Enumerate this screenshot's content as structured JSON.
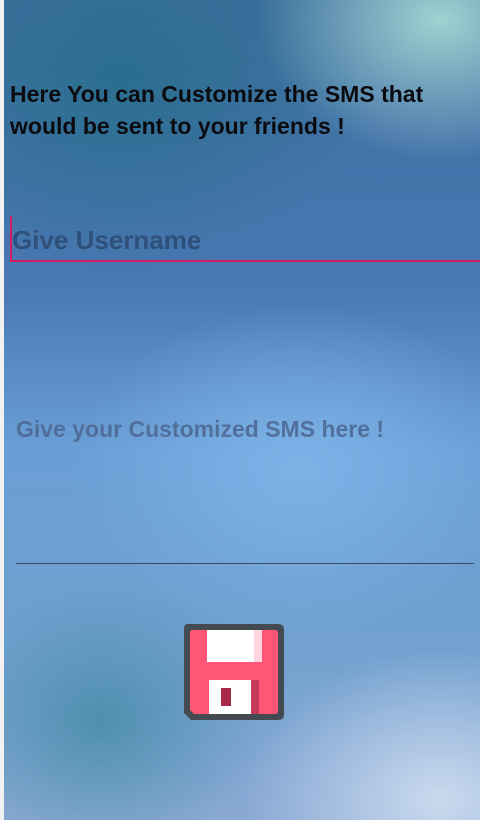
{
  "header": {
    "description": "Here You can Customize the SMS that would be sent to your friends !"
  },
  "form": {
    "username": {
      "value": "",
      "placeholder": "Give Username"
    },
    "sms": {
      "value": "",
      "placeholder": "Give your Customized SMS here !"
    }
  },
  "save": {
    "icon": "floppy-disk-icon"
  },
  "colors": {
    "accent": "#d81b60",
    "floppy_body": "#ff5577",
    "floppy_outline": "#444a52",
    "hint_text": "#4e6a95"
  }
}
